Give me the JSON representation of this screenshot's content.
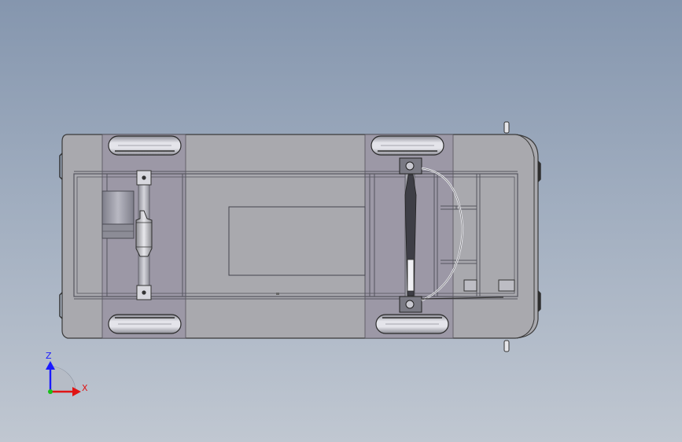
{
  "viewport": {
    "view": "top",
    "model": "vehicle-chassis",
    "background_top": "#8596ae",
    "background_bottom": "#c0c7d1"
  },
  "triad": {
    "z_label": "Z",
    "x_label": "X",
    "z_color": "#1a1aff",
    "x_color": "#e01414",
    "origin_color": "#18c018"
  },
  "colors": {
    "body": "#a9a9ae",
    "wheel_well": "#9a96a4",
    "outline": "#3a3a3a",
    "frame": "#606068",
    "tire": "#d2d2d8"
  }
}
